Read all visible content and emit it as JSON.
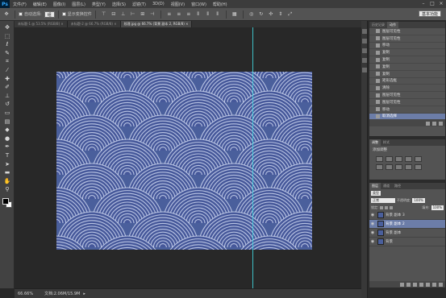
{
  "app": {
    "logo": "Ps"
  },
  "menu": [
    "文件(F)",
    "编辑(E)",
    "图像(I)",
    "图层(L)",
    "类型(Y)",
    "选择(S)",
    "滤镜(T)",
    "3D(D)",
    "视图(V)",
    "窗口(W)",
    "帮助(H)"
  ],
  "window_controls": [
    "–",
    "□",
    "×"
  ],
  "options": {
    "auto_select_label": "自动选择:",
    "auto_select_value": "组",
    "show_transform_label": "显示变换控件",
    "workspace": "基本功能"
  },
  "tools": [
    "move-icon",
    "marquee-icon",
    "lasso-icon",
    "quick-select-icon",
    "crop-icon",
    "eyedropper-icon",
    "healing-icon",
    "brush-icon",
    "clone-stamp-icon",
    "history-brush-icon",
    "eraser-icon",
    "gradient-icon",
    "blur-icon",
    "dodge-icon",
    "pen-icon",
    "type-icon",
    "path-select-icon",
    "shape-icon",
    "hand-icon",
    "zoom-icon"
  ],
  "doc_tabs": [
    {
      "label": "未标题-1 @ 53.5% (RGB/8) ×",
      "active": false
    },
    {
      "label": "未标题-2 @ 66.7% (RGB/8) ×",
      "active": false
    },
    {
      "label": "纹理.jpg @ 66.7% (背景 副本 2, RGB/8) ×",
      "active": true
    }
  ],
  "status": {
    "zoom": "66.66%",
    "doc_info": "文档:2.06M/15.9M"
  },
  "history": {
    "tabs": [
      "历史记录",
      "动作"
    ],
    "rows": [
      {
        "label": "图层可见性",
        "selected": false
      },
      {
        "label": "图层可见性",
        "selected": false
      },
      {
        "label": "移动",
        "selected": false
      },
      {
        "label": "复制",
        "selected": false
      },
      {
        "label": "复制",
        "selected": false
      },
      {
        "label": "复制",
        "selected": false
      },
      {
        "label": "复制",
        "selected": false
      },
      {
        "label": "矩形选框",
        "selected": false
      },
      {
        "label": "清除",
        "selected": false
      },
      {
        "label": "图层可见性",
        "selected": false
      },
      {
        "label": "图层可见性",
        "selected": false
      },
      {
        "label": "移动",
        "selected": false
      },
      {
        "label": "取消选择",
        "selected": true
      }
    ]
  },
  "adjustments": {
    "tabs": [
      "调整",
      "样式"
    ],
    "title": "添加调整"
  },
  "layers": {
    "tabs": [
      "图层",
      "通道",
      "路径"
    ],
    "filter_label": "类型",
    "blend_mode": "正常",
    "opacity_label": "不透明度:",
    "opacity_value": "100%",
    "lock_label": "锁定:",
    "fill_label": "填充:",
    "fill_value": "100%",
    "rows": [
      {
        "name": "背景 副本 3",
        "selected": false
      },
      {
        "name": "背景 副本 2",
        "selected": true
      },
      {
        "name": "背景 副本",
        "selected": false
      },
      {
        "name": "背景",
        "selected": false
      }
    ]
  },
  "colors": {
    "accent": "#6c7da8",
    "guide": "#41d9e0",
    "image_bg": "#4a5f9c"
  }
}
